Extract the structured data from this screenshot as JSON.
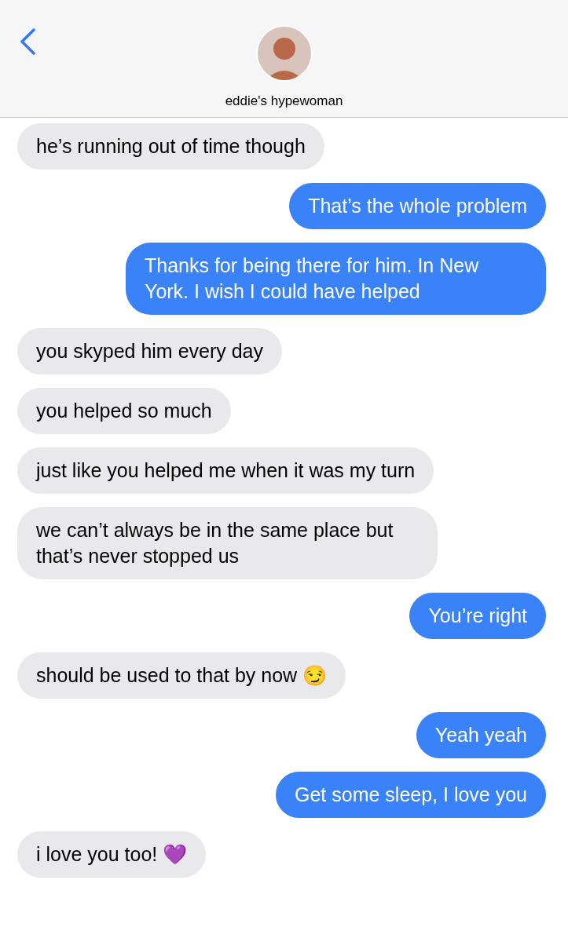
{
  "header": {
    "contact_name": "eddie's hypewoman"
  },
  "messages": [
    {
      "kind": "received",
      "text": "he’s running out of time though"
    },
    {
      "kind": "sent",
      "text": "That’s the whole problem"
    },
    {
      "kind": "sent",
      "text": "Thanks for being there for him. In New York. I wish I could have helped"
    },
    {
      "kind": "received",
      "text": "you skyped him every day"
    },
    {
      "kind": "received",
      "text": "you helped so much"
    },
    {
      "kind": "received",
      "text": "just like you helped me when it was my turn"
    },
    {
      "kind": "received",
      "text": "we can’t always be in the same place but that’s never stopped us"
    },
    {
      "kind": "sent",
      "text": "You’re right"
    },
    {
      "kind": "received",
      "text": "should be used to that by now 😏"
    },
    {
      "kind": "sent",
      "text": "Yeah yeah"
    },
    {
      "kind": "sent",
      "text": "Get some sleep, I love you"
    },
    {
      "kind": "received",
      "text": "i love you too! 💜"
    }
  ]
}
